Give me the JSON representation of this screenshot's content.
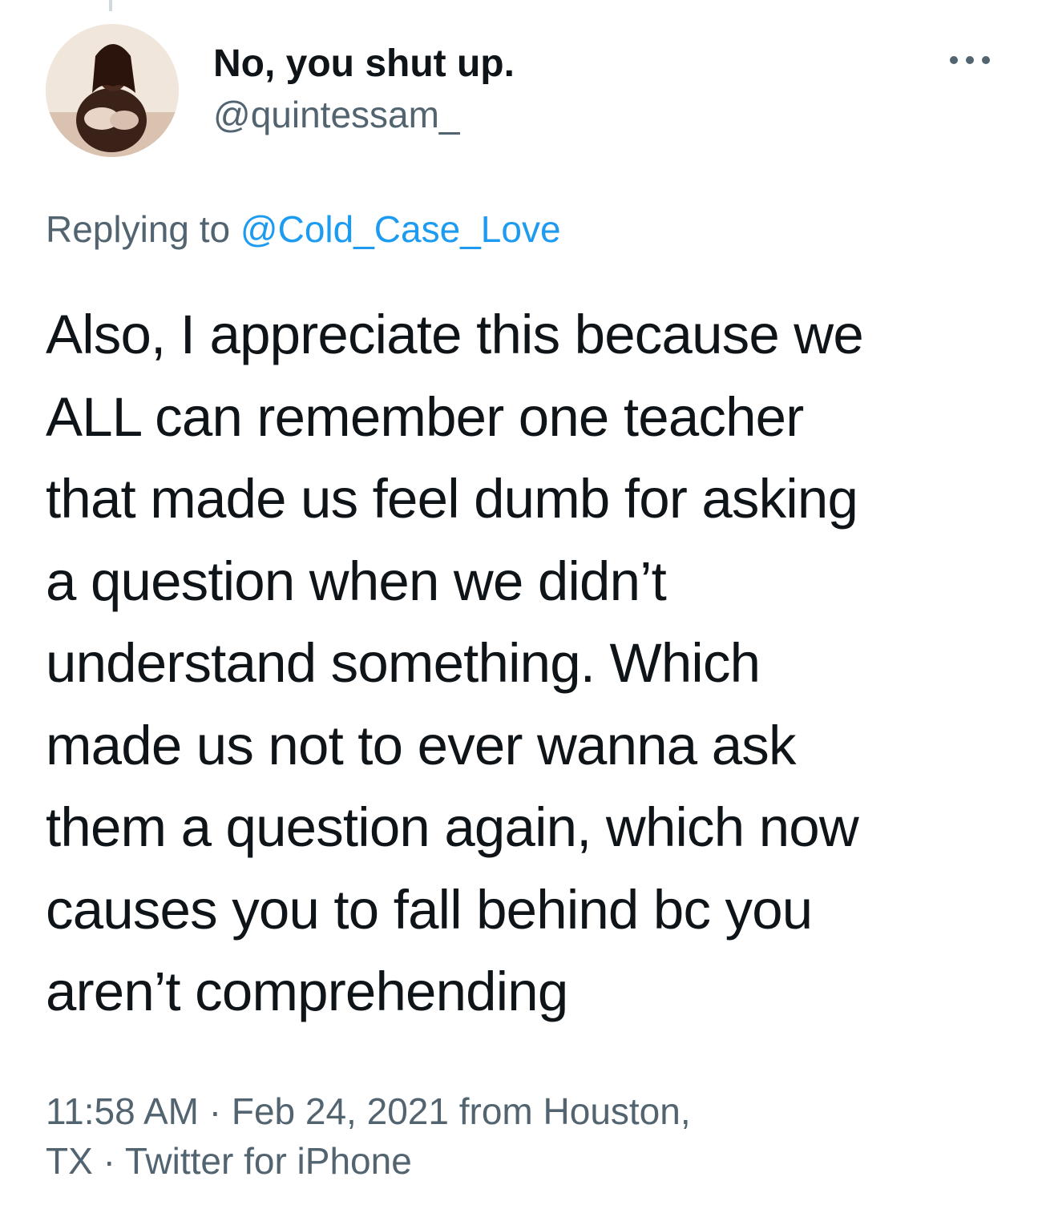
{
  "tweet": {
    "display_name": "No, you shut up.",
    "handle": "@quintessam_",
    "more_icon": "more-horizontal-icon",
    "replying_prefix": "Replying to",
    "replying_to": "@Cold_Case_Love",
    "body_lines": [
      "Also, I appreciate this because we",
      "ALL can remember one teacher",
      "that made us feel dumb for asking",
      "a question when we didn’t",
      "understand something. Which",
      "made us not to ever wanna ask",
      "them a question again, which now",
      "causes you to fall behind bc you",
      "aren’t comprehending"
    ],
    "time": "11:58 AM",
    "separator": "·",
    "date": "Feb 24, 2021",
    "location_prefix": "from",
    "location_line1": "Houston,",
    "location_line2": "TX",
    "source": "Twitter for iPhone"
  },
  "colors": {
    "text_primary": "#0f1419",
    "text_secondary": "#536471",
    "link": "#1d9bf0"
  }
}
